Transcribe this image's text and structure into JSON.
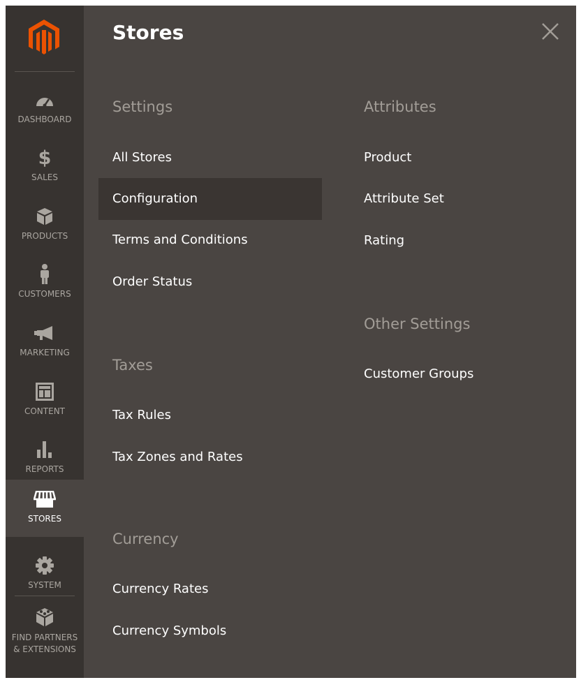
{
  "sidebar": {
    "brand_color": "#eb5202",
    "items": [
      {
        "label": "DASHBOARD",
        "icon": "dashboard-icon"
      },
      {
        "label": "SALES",
        "icon": "dollar-icon"
      },
      {
        "label": "PRODUCTS",
        "icon": "box-icon"
      },
      {
        "label": "CUSTOMERS",
        "icon": "person-icon"
      },
      {
        "label": "MARKETING",
        "icon": "megaphone-icon"
      },
      {
        "label": "CONTENT",
        "icon": "layout-icon"
      },
      {
        "label": "REPORTS",
        "icon": "bar-chart-icon"
      },
      {
        "label": "STORES",
        "icon": "storefront-icon",
        "active": true
      },
      {
        "label": "SYSTEM",
        "icon": "gear-icon"
      },
      {
        "label_line1": "FIND PARTNERS",
        "label_line2": "& EXTENSIONS",
        "icon": "blocks-icon"
      }
    ]
  },
  "panel": {
    "title": "Stores",
    "columns": [
      {
        "groups": [
          {
            "title": "Settings",
            "links": [
              "All Stores",
              "Configuration",
              "Terms and Conditions",
              "Order Status"
            ]
          },
          {
            "title": "Taxes",
            "links": [
              "Tax Rules",
              "Tax Zones and Rates"
            ]
          },
          {
            "title": "Currency",
            "links": [
              "Currency Rates",
              "Currency Symbols"
            ]
          }
        ]
      },
      {
        "groups": [
          {
            "title": "Attributes",
            "links": [
              "Product",
              "Attribute Set",
              "Rating"
            ]
          },
          {
            "title": "Other Settings",
            "links": [
              "Customer Groups"
            ]
          }
        ]
      }
    ],
    "highlighted_link": "Configuration"
  }
}
